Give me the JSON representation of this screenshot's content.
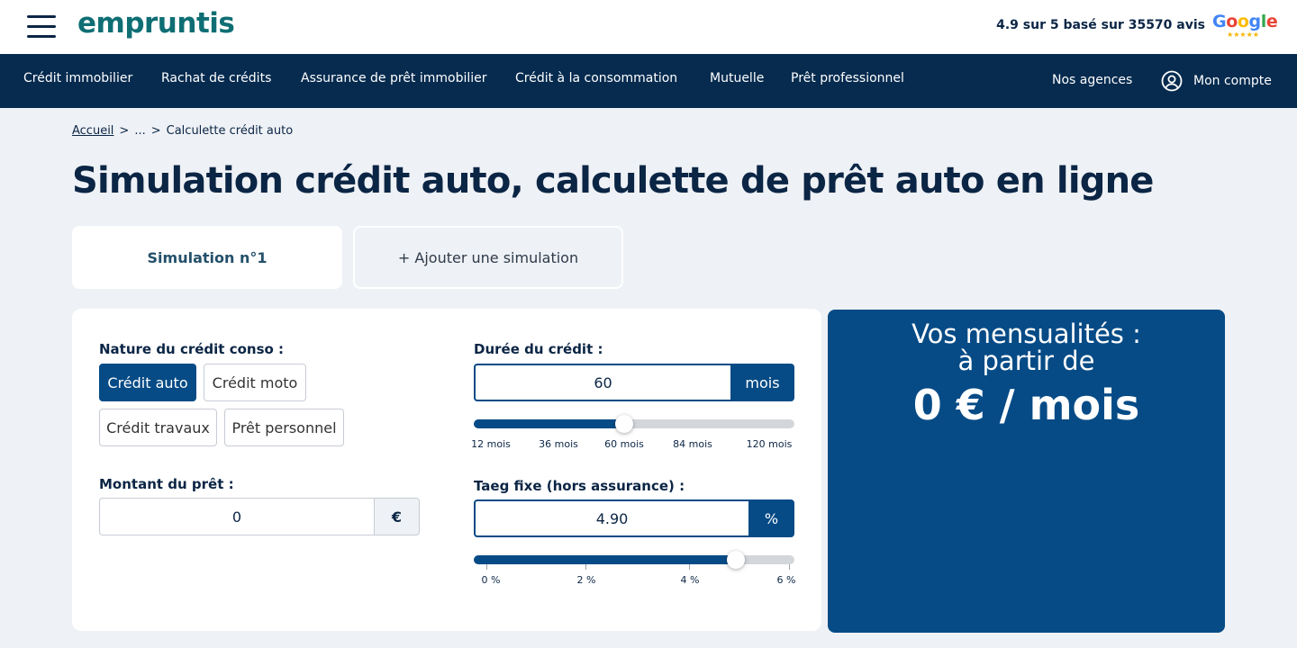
{
  "header": {
    "logo_main": "empruntis",
    "rating_text": "4.9 sur 5 basé sur 35570 avis",
    "google_stars": "★★★★★"
  },
  "nav": {
    "items": [
      {
        "label": "Crédit immobilier"
      },
      {
        "label": "Rachat de crédits"
      },
      {
        "label": "Assurance de prêt immobilier"
      },
      {
        "label": "Crédit à la consommation"
      },
      {
        "label": "Mutuelle"
      },
      {
        "label": "Prêt professionnel"
      }
    ],
    "agencies": "Nos agences",
    "account": "Mon compte"
  },
  "breadcrumb": {
    "home": "Accueil",
    "ellipsis": "...",
    "current": "Calculette crédit auto"
  },
  "page_title": "Simulation crédit auto, calculette de prêt auto en ligne",
  "tabs": {
    "active": "Simulation n°1",
    "add": "+ Ajouter une simulation"
  },
  "form": {
    "nature_label": "Nature du crédit conso :",
    "nature_options": [
      {
        "label": "Crédit auto",
        "selected": true
      },
      {
        "label": "Crédit moto",
        "selected": false
      },
      {
        "label": "Crédit travaux",
        "selected": false
      },
      {
        "label": "Prêt personnel",
        "selected": false
      }
    ],
    "amount_label": "Montant du prêt :",
    "amount_value": "0",
    "amount_unit": "€",
    "duration_label": "Durée du crédit :",
    "duration_value": "60",
    "duration_unit": "mois",
    "duration_slider": {
      "min": 12,
      "max": 120,
      "value": 60
    },
    "duration_ticks": [
      "12 mois",
      "36 mois",
      "60 mois",
      "84 mois",
      "120 mois"
    ],
    "rate_label": "Taeg fixe (hors assurance) :",
    "rate_value": "4.90",
    "rate_unit": "%",
    "rate_slider": {
      "min": 0,
      "max": 6,
      "value": 4.9
    },
    "rate_ticks": [
      "0 %",
      "2 %",
      "4 %",
      "6 %"
    ]
  },
  "result": {
    "line1": "Vos mensualités :",
    "line2": "à partir de",
    "amount": "0 € / mois"
  },
  "colors": {
    "nav_bg": "#062b4f",
    "primary": "#064b86",
    "page_bg": "#eef1f5",
    "logo_teal": "#0e6e74",
    "logo_green": "#5aa83a"
  }
}
